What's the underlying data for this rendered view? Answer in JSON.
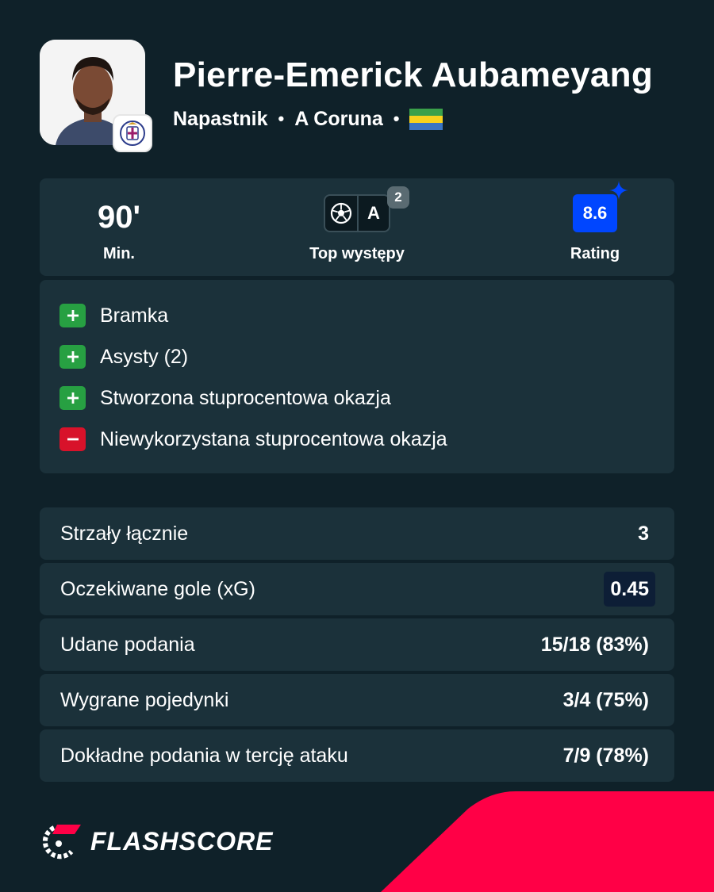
{
  "player": {
    "name": "Pierre-Emerick Aubameyang",
    "position": "Napastnik",
    "separator": "•",
    "club": "A Coruna",
    "flag_colors": [
      "#3aa14a",
      "#f7d21e",
      "#3a75c4"
    ]
  },
  "summary": {
    "minutes_value": "90'",
    "minutes_label": "Min.",
    "top_label": "Top występy",
    "top_letter": "A",
    "top_count": "2",
    "rating_value": "8.6",
    "rating_label": "Rating",
    "rating_color": "#0046ff"
  },
  "events": [
    {
      "sign": "+",
      "type": "positive",
      "text": "Bramka"
    },
    {
      "sign": "+",
      "type": "positive",
      "text": "Asysty (2)"
    },
    {
      "sign": "+",
      "type": "positive",
      "text": "Stworzona stuprocentowa okazja"
    },
    {
      "sign": "−",
      "type": "negative",
      "text": "Niewykorzystana stuprocentowa okazja"
    }
  ],
  "stats": [
    {
      "name": "Strzały łącznie",
      "value": "3"
    },
    {
      "name": "Oczekiwane gole (xG)",
      "value": "0.45"
    },
    {
      "name": "Udane podania",
      "value": "15/18 (83%)"
    },
    {
      "name": "Wygrane pojedynki",
      "value": "3/4 (75%)"
    },
    {
      "name": "Dokładne podania w tercję ataku",
      "value": "7/9 (78%)"
    }
  ],
  "brand": {
    "name": "FLASHSCORE",
    "accent": "#ff0046",
    "background": "#0f2129",
    "card": "#1b313a"
  }
}
